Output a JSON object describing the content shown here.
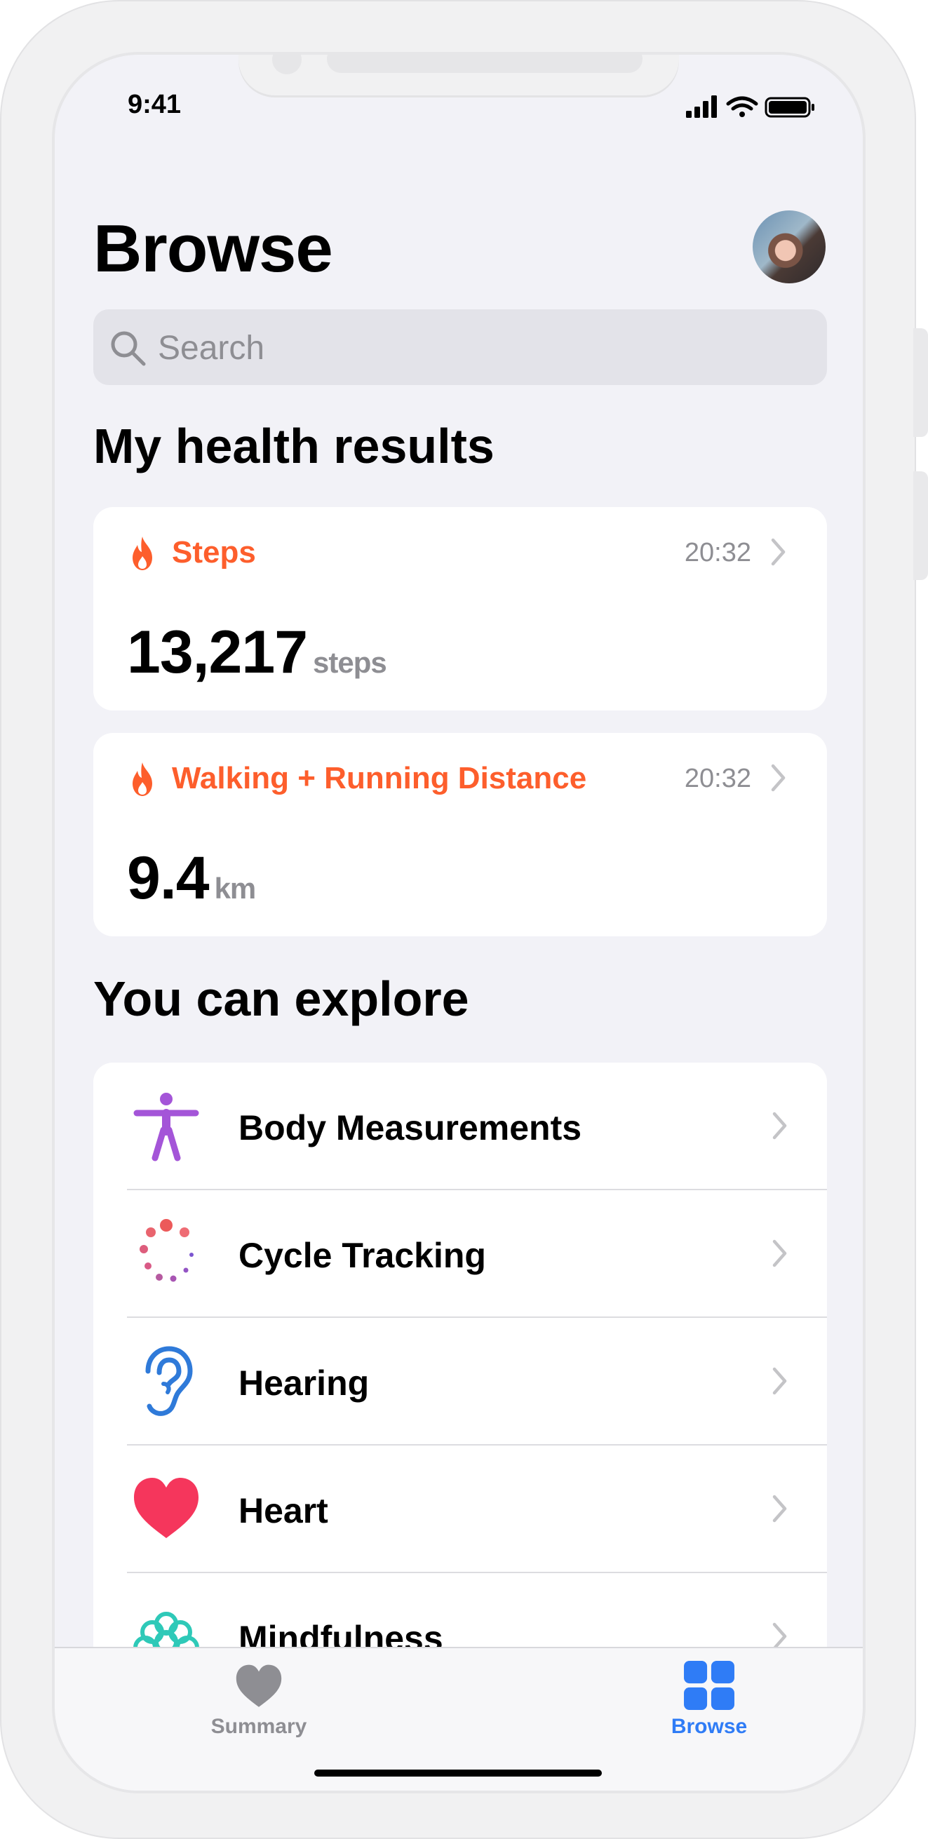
{
  "status_bar": {
    "time": "9:41"
  },
  "header": {
    "title": "Browse"
  },
  "search": {
    "placeholder": "Search"
  },
  "health_results": {
    "title": "My health results",
    "cards": [
      {
        "label": "Steps",
        "time": "20:32",
        "value": "13,217",
        "unit": "steps",
        "icon": "flame-icon"
      },
      {
        "label": "Walking + Running Distance",
        "time": "20:32",
        "value": "9.4",
        "unit": "km",
        "icon": "flame-icon"
      }
    ]
  },
  "explore": {
    "title": "You can explore",
    "items": [
      {
        "label": "Body Measurements",
        "icon": "body-figure-icon",
        "color": "#a455d8"
      },
      {
        "label": "Cycle Tracking",
        "icon": "cycle-dots-icon",
        "color": "#e5587a"
      },
      {
        "label": "Hearing",
        "icon": "ear-icon",
        "color": "#2f7ad9"
      },
      {
        "label": "Heart",
        "icon": "heart-icon",
        "color": "#f5365c"
      },
      {
        "label": "Mindfulness",
        "icon": "brain-icon",
        "color": "#2ec9b8"
      }
    ]
  },
  "tab_bar": {
    "tabs": [
      {
        "label": "Summary",
        "icon": "heart-icon",
        "active": false
      },
      {
        "label": "Browse",
        "icon": "grid-icon",
        "active": true
      }
    ]
  },
  "colors": {
    "accent": "#2f7cf6",
    "orange": "#fd5e2c",
    "inactive": "#8e8e93"
  }
}
